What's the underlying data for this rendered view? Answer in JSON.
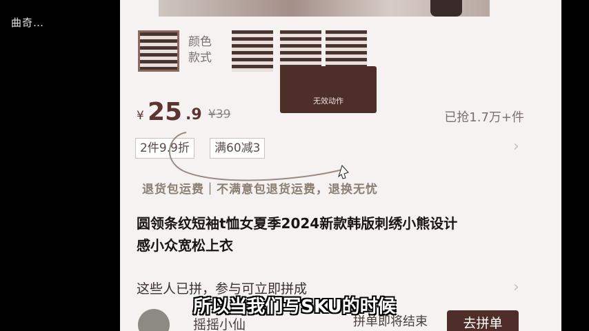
{
  "watermark": "曲奇…",
  "sku": {
    "label_line1": "颜色",
    "label_line2": "款式",
    "tooltip": "无效动作"
  },
  "price": {
    "currency": "¥",
    "integer": "25",
    "decimal": ".9",
    "original": "¥39",
    "sold": "已抢1.7万+件"
  },
  "coupons": [
    "2件9.9折",
    "满60减3"
  ],
  "guarantee": "退货包运费｜不满意包退货运费，退换无忧",
  "title_line1": "圆领条纹短袖t恤女夏季2024新款韩版刺绣小熊设计",
  "title_line2": "感小众宽松上衣",
  "group": {
    "text": "这些人已拼，参与可立即拼成",
    "user": "摇摇小仙",
    "status": "拼单即将结束",
    "join_label": "去拼单"
  },
  "icons": {
    "chevron": "›"
  },
  "caption": "所以当我们写SKU的时候",
  "colors": {
    "accent": "#5c3431",
    "button": "#4f2d29",
    "tooltip": "#4d2e29"
  }
}
